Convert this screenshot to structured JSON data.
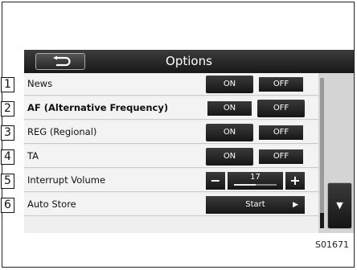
{
  "header": {
    "title": "Options",
    "back_icon": "return-arrow-icon"
  },
  "rows": [
    {
      "num": "1",
      "label": "News",
      "on": "ON",
      "off": "OFF",
      "selected": "OFF"
    },
    {
      "num": "2",
      "label": "AF (Alternative Frequency)",
      "on": "ON",
      "off": "OFF",
      "selected": "ON"
    },
    {
      "num": "3",
      "label": "REG (Regional)",
      "on": "ON",
      "off": "OFF",
      "selected": "OFF"
    },
    {
      "num": "4",
      "label": "TA",
      "on": "ON",
      "off": "OFF",
      "selected": "OFF"
    },
    {
      "num": "5",
      "label": "Interrupt Volume",
      "minus": "−",
      "value": "17",
      "plus": "+",
      "level": 0.5
    },
    {
      "num": "6",
      "label": "Auto Store",
      "button": "Start",
      "arrow": "▶"
    }
  ],
  "scroll": {
    "down_icon": "▼"
  },
  "caption": "S01671"
}
